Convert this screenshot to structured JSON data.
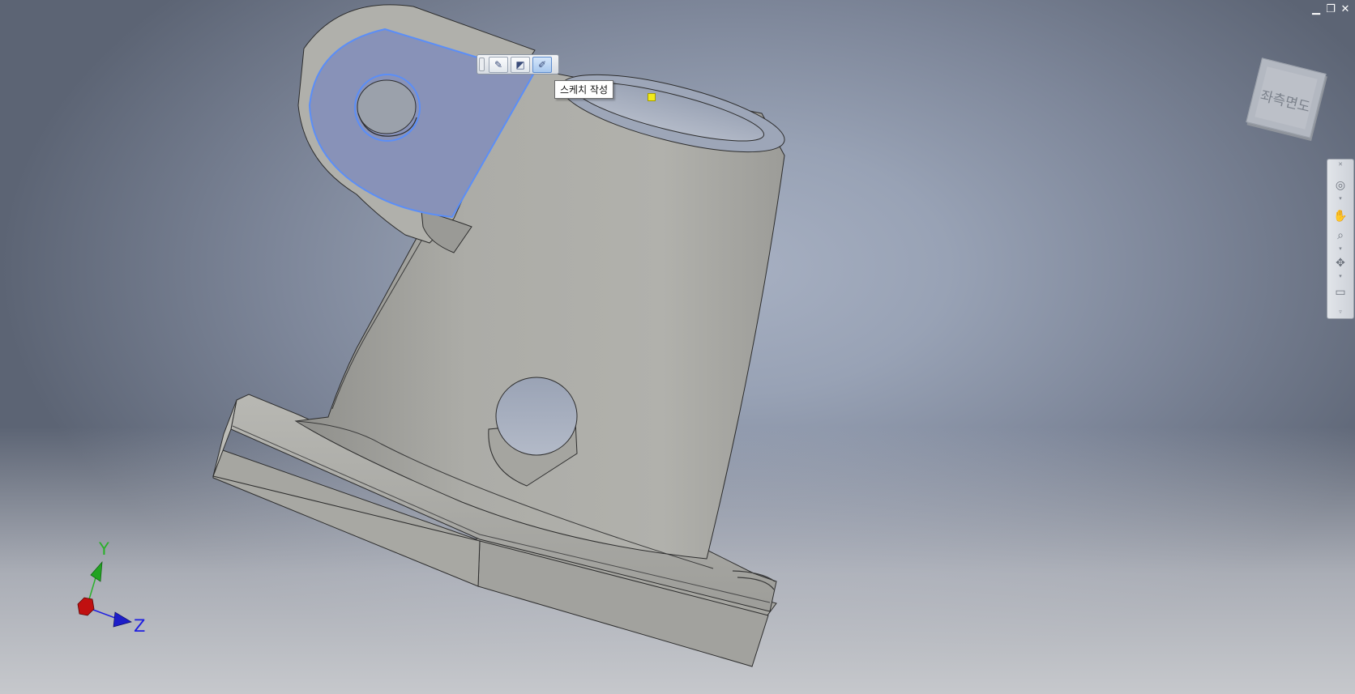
{
  "window_controls": {
    "minimize": "▁",
    "restore": "❐",
    "close": "✕"
  },
  "viewcube": {
    "face_label": "좌측면도"
  },
  "mini_toolbar": {
    "buttons": [
      {
        "name": "edit-feature",
        "icon": "pencil-icon"
      },
      {
        "name": "edit-sketch",
        "icon": "sketch-icon"
      },
      {
        "name": "create-sketch",
        "icon": "create-sketch-icon"
      }
    ]
  },
  "tooltip": {
    "text": "스케치 작성"
  },
  "triad": {
    "y_label": "Y",
    "z_label": "Z"
  },
  "navigation_bar": {
    "items": [
      "steering-wheel-icon",
      "pan-icon",
      "zoom-icon",
      "orbit-icon",
      "look-at-icon"
    ]
  },
  "colors": {
    "model_face": "#a9a9a4",
    "selected_face": "#8892b8",
    "selection_edge": "#5b8ef7",
    "y_axis": "#2bb12b",
    "z_axis": "#1e1ee0",
    "x_axis": "#c01010"
  }
}
